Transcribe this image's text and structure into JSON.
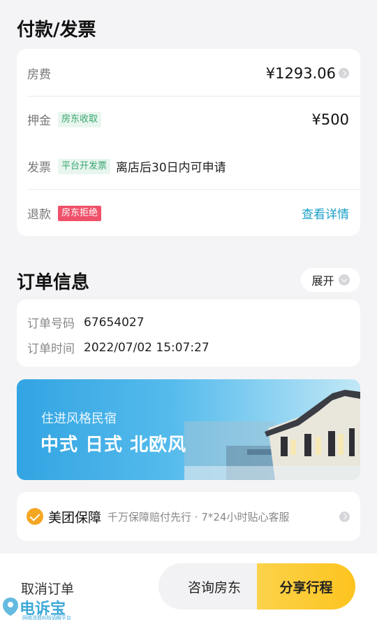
{
  "payment": {
    "title": "付款/发票",
    "room_fee": {
      "label": "房费",
      "amount": "¥1293.06"
    },
    "deposit": {
      "label": "押金",
      "tag": "房东收取",
      "amount": "¥500"
    },
    "invoice": {
      "label": "发票",
      "tag": "平台开发票",
      "note": "离店后30日内可申请"
    },
    "refund": {
      "label": "退款",
      "tag": "房东拒绝",
      "link": "查看详情"
    }
  },
  "order": {
    "title": "订单信息",
    "expand_label": "展开",
    "number_label": "订单号码",
    "number_value": "67654027",
    "time_label": "订单时间",
    "time_value": "2022/07/02 15:07:27"
  },
  "banner": {
    "subtitle": "住进风格民宿",
    "headline": "中式 日式 北欧风"
  },
  "guarantee": {
    "title": "美团保障",
    "desc": "千万保障赔付先行 · 7*24小时贴心客服"
  },
  "bottom": {
    "cancel_label": "取消订单",
    "consult_label": "咨询房东",
    "share_label": "分享行程"
  },
  "watermark": {
    "logo": "电诉宝",
    "sub": "网络消费纠纷调解平台"
  },
  "colors": {
    "accent_link": "#1aa0c8",
    "tag_green": "#3aa66f",
    "tag_red": "#f0516a",
    "share_yellow": "#fdc41f"
  }
}
